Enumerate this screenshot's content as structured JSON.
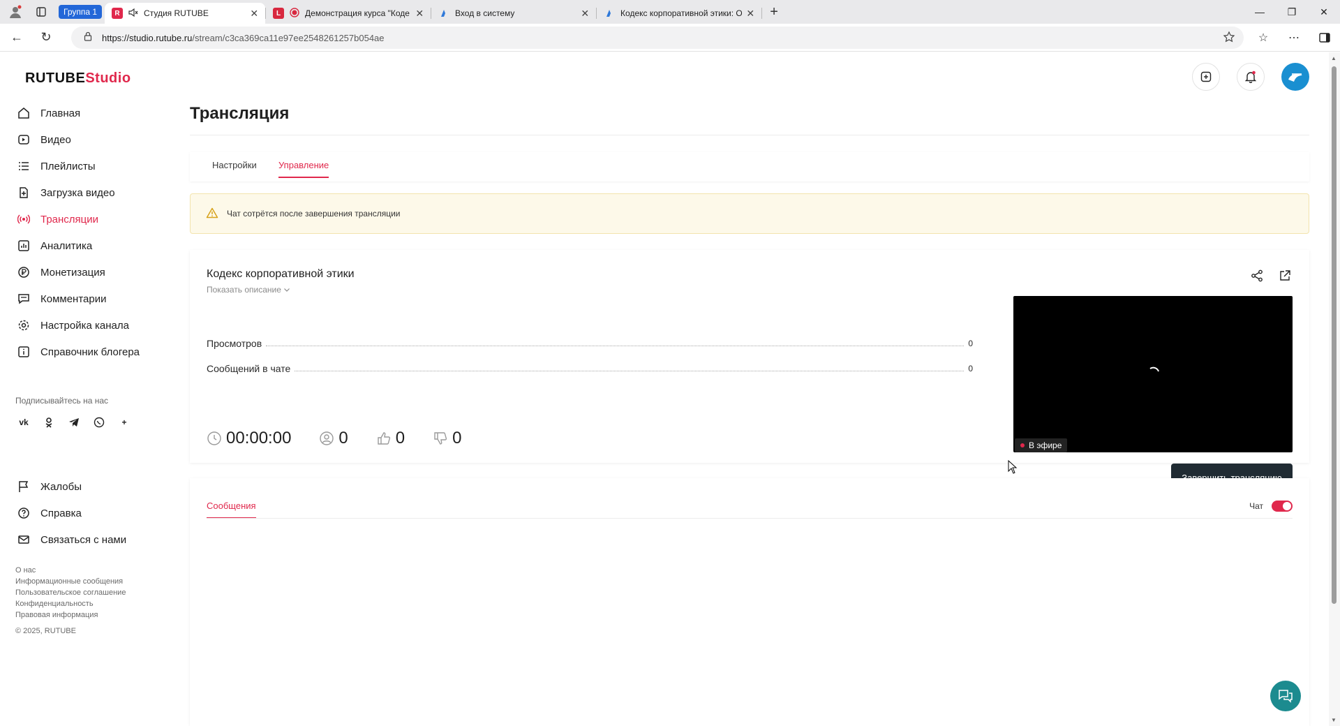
{
  "browser": {
    "group_label": "Группа 1",
    "tabs": [
      {
        "title": "Студия RUTUBE",
        "active": true,
        "favicon": "rutube-icon"
      },
      {
        "title": "Демонстрация курса \"Коде",
        "active": false,
        "favicon": "record-icon"
      },
      {
        "title": "Вход в систему",
        "active": false,
        "favicon": "edge-icon"
      },
      {
        "title": "Кодекс корпоративной этики: О",
        "active": false,
        "favicon": "edge-icon"
      }
    ],
    "url_host": "https://studio.rutube.ru",
    "url_path": "/stream/c3ca369ca11e97ee2548261257b054ae"
  },
  "logo": {
    "brand": "RUTUBE",
    "product": "Studio"
  },
  "sidebar": {
    "items": [
      {
        "label": "Главная",
        "icon": "home-icon"
      },
      {
        "label": "Видео",
        "icon": "video-icon"
      },
      {
        "label": "Плейлисты",
        "icon": "playlist-icon"
      },
      {
        "label": "Загрузка видео",
        "icon": "upload-icon"
      },
      {
        "label": "Трансляции",
        "icon": "broadcast-icon",
        "active": true
      },
      {
        "label": "Аналитика",
        "icon": "analytics-icon"
      },
      {
        "label": "Монетизация",
        "icon": "ruble-icon"
      },
      {
        "label": "Комментарии",
        "icon": "comment-icon"
      },
      {
        "label": "Настройка канала",
        "icon": "gear-icon"
      },
      {
        "label": "Справочник блогера",
        "icon": "book-icon"
      }
    ],
    "subscribe_label": "Подписывайтесь на нас",
    "socials": [
      "vk",
      "ok",
      "telegram",
      "viber",
      "more"
    ],
    "secondary": [
      {
        "label": "Жалобы",
        "icon": "flag-icon"
      },
      {
        "label": "Справка",
        "icon": "help-icon"
      },
      {
        "label": "Связаться с нами",
        "icon": "mail-icon"
      }
    ],
    "footer_links": [
      "О нас",
      "Информационные сообщения",
      "Пользовательское соглашение",
      "Конфиденциальность",
      "Правовая информация"
    ],
    "copyright": "© 2025, RUTUBE"
  },
  "main": {
    "title": "Трансляция",
    "tabs": [
      {
        "label": "Настройки",
        "active": false
      },
      {
        "label": "Управление",
        "active": true
      }
    ],
    "notice": "Чат сотрётся после завершения трансляции",
    "stream": {
      "title": "Кодекс корпоративной этики",
      "show_description": "Показать описание",
      "stats": [
        {
          "label": "Просмотров",
          "value": "0"
        },
        {
          "label": "Сообщений в чате",
          "value": "0"
        }
      ],
      "timer": "00:00:00",
      "viewers": "0",
      "likes": "0",
      "dislikes": "0",
      "live_label": "В эфире",
      "end_button": "Завершить трансляцию"
    },
    "chat": {
      "tab_label": "Сообщения",
      "toggle_label": "Чат",
      "toggle_on": true
    }
  },
  "colors": {
    "accent": "#e0284c",
    "button_dark": "#202b33",
    "notice_bg": "#fdf9e9"
  }
}
